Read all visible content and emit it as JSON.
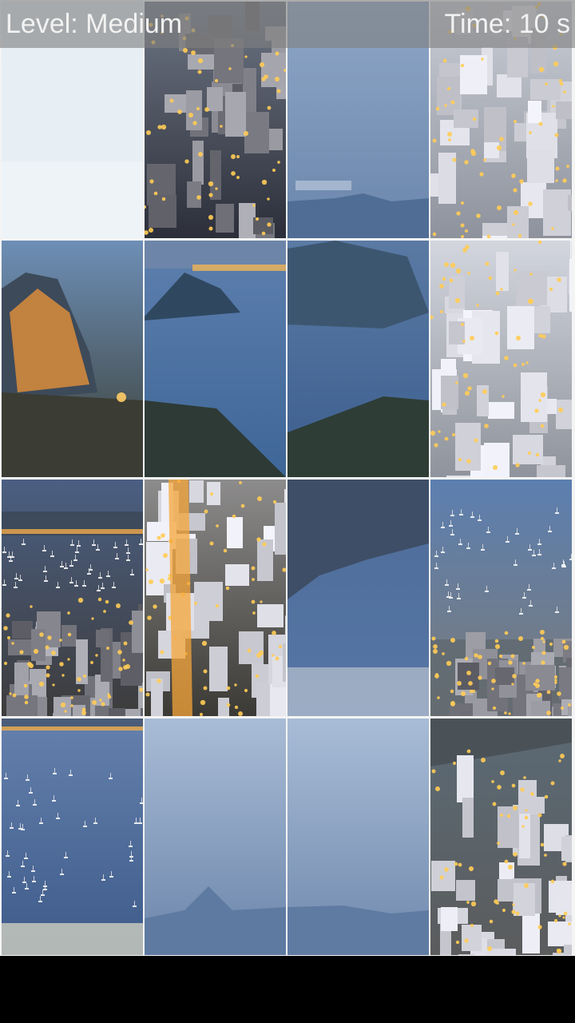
{
  "hud": {
    "level_text": "Level: Medium",
    "time_text": "Time: 10 s"
  },
  "puzzle": {
    "rows": 4,
    "cols": 4,
    "tiles": [
      {
        "scene": "sky-haze",
        "colors": {
          "top": "#e6eef3",
          "bottom": "#e9f0f5"
        }
      },
      {
        "scene": "city-night",
        "colors": {
          "top": "#6d7583",
          "bottom": "#2c2f3a"
        }
      },
      {
        "scene": "sky-mountain",
        "colors": {
          "top": "#8fa7c8",
          "bottom": "#6a86ab"
        }
      },
      {
        "scene": "city-white",
        "colors": {
          "top": "#c9cdd6",
          "bottom": "#8e929c"
        }
      },
      {
        "scene": "sugarloaf-peak",
        "colors": {
          "top": "#6d8fb6",
          "bottom": "#3a3d34"
        }
      },
      {
        "scene": "bay-hill",
        "colors": {
          "top": "#5d7fae",
          "bottom": "#3e6697"
        }
      },
      {
        "scene": "bay-mountain",
        "colors": {
          "top": "#5a7aa4",
          "bottom": "#3c5e8e"
        }
      },
      {
        "scene": "city-white",
        "colors": {
          "top": "#d3d6de",
          "bottom": "#8f939c"
        }
      },
      {
        "scene": "harbor-lights",
        "colors": {
          "top": "#4b5f82",
          "bottom": "#3d3c3c"
        }
      },
      {
        "scene": "street-night",
        "colors": {
          "top": "#8d8c8c",
          "bottom": "#3b3a35"
        }
      },
      {
        "scene": "lagoon",
        "colors": {
          "top": "#4f6c98",
          "bottom": "#5576a6"
        }
      },
      {
        "scene": "marina",
        "colors": {
          "top": "#5c7fb0",
          "bottom": "#7a7b7a"
        }
      },
      {
        "scene": "marina-boats",
        "colors": {
          "top": "#6580ac",
          "bottom": "#3d5b8a"
        }
      },
      {
        "scene": "sky-peak",
        "colors": {
          "top": "#a9bcd6",
          "bottom": "#6b85aa"
        }
      },
      {
        "scene": "sky-ridge",
        "colors": {
          "top": "#a8bcd6",
          "bottom": "#7089ad"
        }
      },
      {
        "scene": "city-hill",
        "colors": {
          "top": "#5b6a75",
          "bottom": "#5b5c5d"
        }
      }
    ]
  }
}
